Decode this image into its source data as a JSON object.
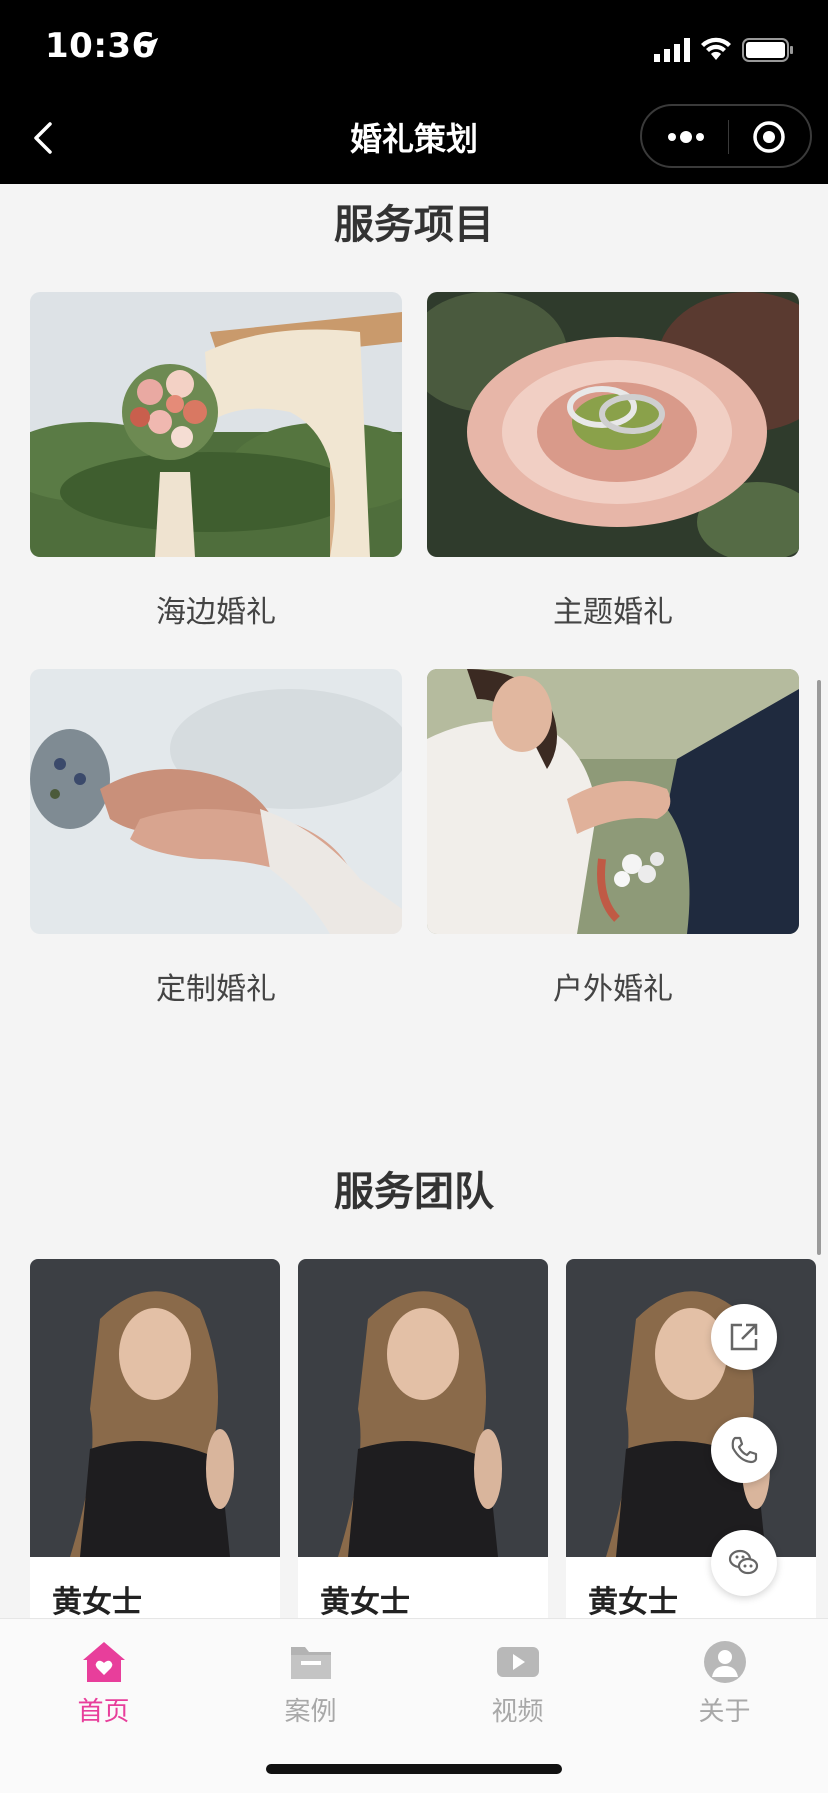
{
  "status_bar": {
    "time": "10:36"
  },
  "nav": {
    "title": "婚礼策划"
  },
  "services": {
    "title": "服务项目",
    "items": [
      {
        "label": "海边婚礼"
      },
      {
        "label": "主题婚礼"
      },
      {
        "label": "定制婚礼"
      },
      {
        "label": "户外婚礼"
      }
    ]
  },
  "team": {
    "title": "服务团队",
    "members": [
      {
        "name": "黄女士"
      },
      {
        "name": "黄女士"
      },
      {
        "name": "黄女士"
      }
    ]
  },
  "floating_actions": [
    "share-icon",
    "phone-icon",
    "wechat-icon"
  ],
  "tabbar": {
    "active_color": "#e83e9b",
    "inactive_color": "#a8a8a8",
    "tabs": [
      {
        "label": "首页",
        "icon": "home-icon",
        "active": true
      },
      {
        "label": "案例",
        "icon": "folder-icon",
        "active": false
      },
      {
        "label": "视频",
        "icon": "video-icon",
        "active": false
      },
      {
        "label": "关于",
        "icon": "user-icon",
        "active": false
      }
    ]
  }
}
